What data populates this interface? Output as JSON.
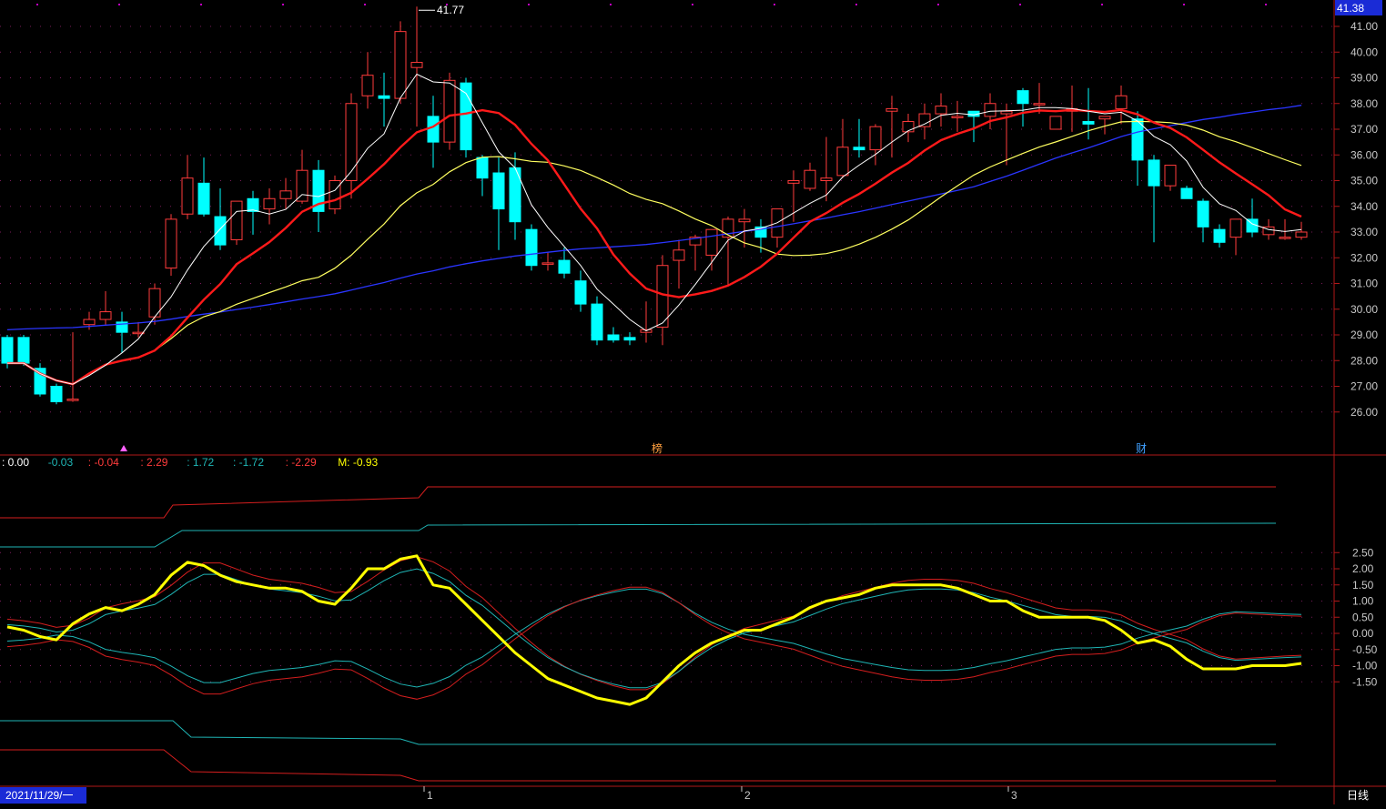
{
  "colors": {
    "background": "#000000",
    "frame": "#b01818",
    "up": "#ff3b3b",
    "down": "#00ffff",
    "ma_white": "#ffffff",
    "ma_red": "#ff1a1a",
    "ma_yellow": "#ffff60",
    "ma_blue": "#2a35ff",
    "osc_main": "#ffff00",
    "osc_cyan": "#1fb5b5",
    "osc_red": "#d41e1e",
    "grid_dot": "#7a1a5a",
    "axis_text": "#c8c8c8",
    "bull_label": "#ff2a2a",
    "bear_label": "#39ff39"
  },
  "price_axis": {
    "current_price_box": "41.38",
    "ticks": [
      "41.00",
      "40.00",
      "39.00",
      "38.00",
      "37.00",
      "36.00",
      "35.00",
      "34.00",
      "33.00",
      "32.00",
      "31.00",
      "30.00",
      "29.00",
      "28.00",
      "27.00",
      "26.00"
    ]
  },
  "osc_axis": {
    "ticks": [
      "2.50",
      "2.00",
      "1.50",
      "1.00",
      "0.50",
      "0.00",
      "-0.50",
      "-1.00",
      "-1.50"
    ]
  },
  "osc_header": {
    "items": [
      {
        "text": ": 0.00",
        "color": "#ffffff"
      },
      {
        "text": "-0.03",
        "color": "#1fb5b5"
      },
      {
        "text": ": -0.04",
        "color": "#ff3b3b"
      },
      {
        "text": ": 2.29",
        "color": "#ff3b3b"
      },
      {
        "text": ": 1.72",
        "color": "#1fb5b5"
      },
      {
        "text": ": -1.72",
        "color": "#1fb5b5"
      },
      {
        "text": ": -2.29",
        "color": "#ff3b3b"
      },
      {
        "text": "M: -0.93",
        "color": "#ffff00"
      }
    ]
  },
  "high_marker": "41.77",
  "markers": {
    "bang": "榜",
    "cai": "财"
  },
  "bottom_bar": {
    "date": "2021/11/29/一",
    "months": [
      "1",
      "2",
      "3"
    ],
    "period_label": "日线"
  },
  "chart_data": [
    {
      "type": "candlestick",
      "title": "",
      "ylim": [
        25.0,
        42.0
      ],
      "candles": [
        [
          28.9,
          29.0,
          27.9,
          27.7
        ],
        [
          28.9,
          29.0,
          27.9,
          27.8
        ],
        [
          27.7,
          27.9,
          26.7,
          26.6
        ],
        [
          27.0,
          27.1,
          26.4,
          26.3
        ],
        [
          26.5,
          29.1,
          26.5,
          26.4
        ],
        [
          29.4,
          29.9,
          29.6,
          29.2
        ],
        [
          29.6,
          30.7,
          29.9,
          29.4
        ],
        [
          29.5,
          29.9,
          29.1,
          28.3
        ],
        [
          29.1,
          29.5,
          29.1,
          28.9
        ],
        [
          29.7,
          31.0,
          30.8,
          29.4
        ],
        [
          31.6,
          33.7,
          33.5,
          31.3
        ],
        [
          33.7,
          36.0,
          35.1,
          33.5
        ],
        [
          34.9,
          35.9,
          33.7,
          33.6
        ],
        [
          33.6,
          34.7,
          32.5,
          32.3
        ],
        [
          32.7,
          34.1,
          34.2,
          32.5
        ],
        [
          34.3,
          34.6,
          33.8,
          32.9
        ],
        [
          33.9,
          34.7,
          34.3,
          33.3
        ],
        [
          34.3,
          35.1,
          34.6,
          33.9
        ],
        [
          34.2,
          36.2,
          35.4,
          34.1
        ],
        [
          35.4,
          35.8,
          33.8,
          33.0
        ],
        [
          33.9,
          35.2,
          35.0,
          33.7
        ],
        [
          35.0,
          38.4,
          38.0,
          34.3
        ],
        [
          38.3,
          40.0,
          39.1,
          37.8
        ],
        [
          38.3,
          39.2,
          38.2,
          37.1
        ],
        [
          38.2,
          41.2,
          40.8,
          38.0
        ],
        [
          39.4,
          41.77,
          39.6,
          37.1
        ],
        [
          37.5,
          38.3,
          36.5,
          35.5
        ],
        [
          36.5,
          39.2,
          38.9,
          36.2
        ],
        [
          38.8,
          39.0,
          36.2,
          35.9
        ],
        [
          35.9,
          36.0,
          35.1,
          34.4
        ],
        [
          35.3,
          35.9,
          33.9,
          32.3
        ],
        [
          35.5,
          36.1,
          33.4,
          32.7
        ],
        [
          33.1,
          33.3,
          31.7,
          31.5
        ],
        [
          31.8,
          32.2,
          31.8,
          31.5
        ],
        [
          31.9,
          32.4,
          31.4,
          31.2
        ],
        [
          31.1,
          31.5,
          30.2,
          29.9
        ],
        [
          30.2,
          30.5,
          28.8,
          28.6
        ],
        [
          29.0,
          29.3,
          28.8,
          28.7
        ],
        [
          28.9,
          29.1,
          28.8,
          28.6
        ],
        [
          29.1,
          30.3,
          29.2,
          28.7
        ],
        [
          29.3,
          32.1,
          31.7,
          28.6
        ],
        [
          31.9,
          32.7,
          32.3,
          30.8
        ],
        [
          32.5,
          32.9,
          32.8,
          31.5
        ],
        [
          32.1,
          32.2,
          33.1,
          31.5
        ],
        [
          32.8,
          33.6,
          33.5,
          30.9
        ],
        [
          33.4,
          33.9,
          33.5,
          32.4
        ],
        [
          33.2,
          33.5,
          32.8,
          32.2
        ],
        [
          32.8,
          33.9,
          33.9,
          32.4
        ],
        [
          34.9,
          35.4,
          35.0,
          33.4
        ],
        [
          34.7,
          35.7,
          35.4,
          34.6
        ],
        [
          35.0,
          36.7,
          35.1,
          34.2
        ],
        [
          35.2,
          37.4,
          36.3,
          35.1
        ],
        [
          36.3,
          37.4,
          36.2,
          35.9
        ],
        [
          36.2,
          37.2,
          37.1,
          35.6
        ],
        [
          37.7,
          38.3,
          37.8,
          35.9
        ],
        [
          36.9,
          37.6,
          37.3,
          36.5
        ],
        [
          37.1,
          38.0,
          37.6,
          36.6
        ],
        [
          37.6,
          38.4,
          37.9,
          37.1
        ],
        [
          37.5,
          38.1,
          37.5,
          36.9
        ],
        [
          37.7,
          37.5,
          37.5,
          36.5
        ],
        [
          37.5,
          38.4,
          38.0,
          37.0
        ],
        [
          37.6,
          38.0,
          37.7,
          35.6
        ],
        [
          38.5,
          38.6,
          38.0,
          37.1
        ],
        [
          38.0,
          38.8,
          38.0,
          37.6
        ],
        [
          37.0,
          37.5,
          37.5,
          37.0
        ],
        [
          37.7,
          38.7,
          37.8,
          36.9
        ],
        [
          37.3,
          38.6,
          37.2,
          36.6
        ],
        [
          37.4,
          37.2,
          37.5,
          36.8
        ],
        [
          37.8,
          38.7,
          38.3,
          37.2
        ],
        [
          37.4,
          37.7,
          35.8,
          34.8
        ],
        [
          35.8,
          36.0,
          34.8,
          32.6
        ],
        [
          34.8,
          35.1,
          35.6,
          34.6
        ],
        [
          34.7,
          34.8,
          34.3,
          34.3
        ],
        [
          34.2,
          34.3,
          33.2,
          32.6
        ],
        [
          33.1,
          33.3,
          32.6,
          32.4
        ],
        [
          32.8,
          33.5,
          33.5,
          32.1
        ],
        [
          33.5,
          34.3,
          33.0,
          32.8
        ],
        [
          32.9,
          33.5,
          33.2,
          32.7
        ],
        [
          32.8,
          33.5,
          32.8,
          32.7
        ],
        [
          32.8,
          33.4,
          33.0,
          32.7
        ]
      ]
    },
    {
      "type": "line",
      "title": "",
      "ylim": [
        -2.4,
        2.6
      ],
      "series": [
        {
          "name": "M",
          "values": [
            0.2,
            0.1,
            -0.1,
            -0.2,
            0.3,
            0.6,
            0.8,
            0.7,
            0.9,
            1.2,
            1.8,
            2.2,
            2.1,
            1.8,
            1.6,
            1.5,
            1.4,
            1.4,
            1.3,
            1.0,
            0.9,
            1.4,
            2.0,
            2.0,
            2.3,
            2.4,
            1.5,
            1.4,
            0.9,
            0.4,
            -0.1,
            -0.6,
            -1.0,
            -1.4,
            -1.6,
            -1.8,
            -2.0,
            -2.1,
            -2.2,
            -2.0,
            -1.5,
            -1.0,
            -0.6,
            -0.3,
            -0.1,
            0.1,
            0.1,
            0.3,
            0.5,
            0.8,
            1.0,
            1.1,
            1.2,
            1.4,
            1.5,
            1.5,
            1.5,
            1.5,
            1.4,
            1.2,
            1.0,
            1.0,
            0.7,
            0.5,
            0.5,
            0.5,
            0.5,
            0.4,
            0.1,
            -0.3,
            -0.2,
            -0.4,
            -0.8,
            -1.1,
            -1.1,
            -1.1,
            -1.0,
            -1.0,
            -1.0,
            -0.93
          ]
        }
      ]
    }
  ]
}
